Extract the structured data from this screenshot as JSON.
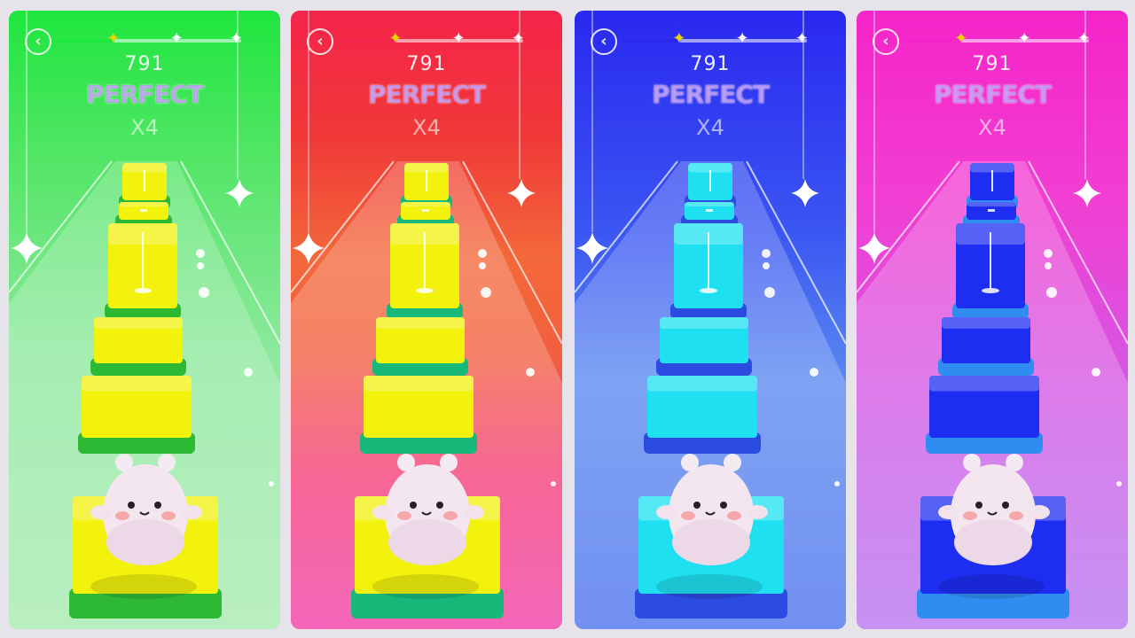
{
  "panels": [
    {
      "theme": "green",
      "score": "791",
      "judgement": "PERFECT",
      "combo": "X4",
      "progress": 0.32,
      "tile_color": "#f2f20c",
      "tile_side": "#2eb935",
      "bg_accent": "#1ee63e",
      "back_icon": "chevron-left-icon",
      "star_icon": "sparkle-icon"
    },
    {
      "theme": "red",
      "score": "791",
      "judgement": "PERFECT",
      "combo": "X4",
      "progress": 0.32,
      "tile_color": "#f2f20c",
      "tile_side": "#17b87a",
      "bg_accent": "#f5244a",
      "back_icon": "chevron-left-icon",
      "star_icon": "sparkle-icon"
    },
    {
      "theme": "blue",
      "score": "791",
      "judgement": "PERFECT",
      "combo": "X4",
      "progress": 0.32,
      "tile_color": "#1ee0f0",
      "tile_side": "#2c4be0",
      "bg_accent": "#2a28f0",
      "back_icon": "chevron-left-icon",
      "star_icon": "sparkle-icon"
    },
    {
      "theme": "pink",
      "score": "791",
      "judgement": "PERFECT",
      "combo": "X4",
      "progress": 0.32,
      "tile_color": "#1d2ef2",
      "tile_side": "#2f8cf0",
      "bg_accent": "#f524c8",
      "back_icon": "chevron-left-icon",
      "star_icon": "sparkle-icon"
    }
  ]
}
